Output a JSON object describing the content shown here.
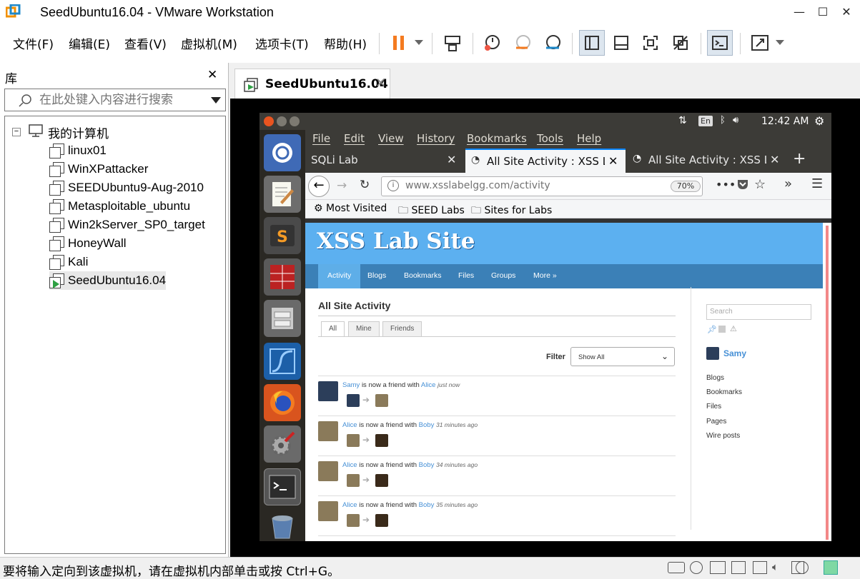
{
  "window": {
    "title": "SeedUbuntu16.04 - VMware Workstation"
  },
  "menu": [
    "文件(F)",
    "编辑(E)",
    "查看(V)",
    "虚拟机(M)",
    "选项卡(T)",
    "帮助(H)"
  ],
  "library": {
    "title": "库",
    "search_placeholder": "在此处键入内容进行搜索",
    "root": "我的计算机",
    "vms": [
      "linux01",
      "WinXPattacker",
      "SEEDUbuntu9-Aug-2010",
      "Metasploitable_ubuntu",
      "Win2kServer_SP0_target",
      "HoneyWall",
      "Kali",
      "SeedUbuntu16.04"
    ]
  },
  "vm_tab": {
    "label": "SeedUbuntu16.04"
  },
  "statusbar": {
    "message": "要将输入定向到该虚拟机，请在虚拟机内部单击或按 Ctrl+G。"
  },
  "guest": {
    "panel": {
      "lang": "En",
      "clock": "12:42 AM"
    },
    "firefox": {
      "menu": [
        "File",
        "Edit",
        "View",
        "History",
        "Bookmarks",
        "Tools",
        "Help"
      ],
      "tabs": [
        "SQLi Lab",
        "All Site Activity : XSS Lab",
        "All Site Activity : XSS Lab"
      ],
      "url": "www.xsslabelgg.com/activity",
      "zoom": "70%",
      "bookmarks": [
        "Most Visited",
        "SEED Labs",
        "Sites for Labs"
      ]
    },
    "site": {
      "title": "XSS Lab Site",
      "nav": [
        "Activity",
        "Blogs",
        "Bookmarks",
        "Files",
        "Groups",
        "More »"
      ],
      "heading": "All Site Activity",
      "tabs": [
        "All",
        "Mine",
        "Friends"
      ],
      "filter_label": "Filter",
      "filter_value": "Show All",
      "activity": [
        {
          "subject": "Samy",
          "verb": "is now a friend with",
          "object": "Alice",
          "time": "just now"
        },
        {
          "subject": "Alice",
          "verb": "is now a friend with",
          "object": "Boby",
          "time": "31 minutes ago"
        },
        {
          "subject": "Alice",
          "verb": "is now a friend with",
          "object": "Boby",
          "time": "34 minutes ago"
        },
        {
          "subject": "Alice",
          "verb": "is now a friend with",
          "object": "Boby",
          "time": "35 minutes ago"
        }
      ],
      "sidebar": {
        "search_placeholder": "Search",
        "user": "Samy",
        "links": [
          "Blogs",
          "Bookmarks",
          "Files",
          "Pages",
          "Wire posts"
        ]
      }
    }
  }
}
